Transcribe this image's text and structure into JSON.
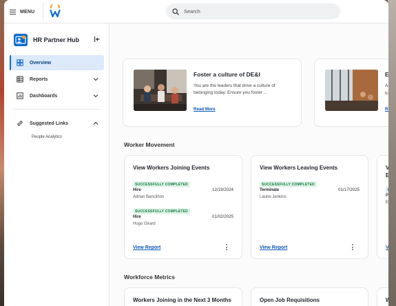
{
  "topbar": {
    "menu_label": "MENU",
    "search_placeholder": "Search"
  },
  "sidebar": {
    "hub_title": "HR Partner Hub",
    "items": [
      {
        "label": "Overview",
        "icon": "dashboard-icon"
      },
      {
        "label": "Reports",
        "icon": "table-icon"
      },
      {
        "label": "Dashboards",
        "icon": "chart-icon"
      }
    ],
    "suggested": {
      "label": "Suggested Links",
      "icon": "link-icon"
    },
    "suggested_items": [
      "People Analytics"
    ]
  },
  "features": [
    {
      "title": "Foster a culture of DE&I",
      "description": "You are the leaders that drive a culture of belonging today. Ensure you foster ...",
      "link": "Read More"
    },
    {
      "title": "Er",
      "description": "As",
      "description2": "tc",
      "link": "Re"
    }
  ],
  "worker_movement": {
    "title": "Worker Movement",
    "cards": [
      {
        "title": "View Workers Joining Events",
        "events": [
          {
            "status": "SUCCESSFULLY COMPLETED",
            "type": "Hire",
            "date": "12/19/2024",
            "name": "Adrian Bancilhon"
          },
          {
            "status": "SUCCESSFULLY COMPLETED",
            "type": "Hire",
            "date": "01/02/2025",
            "name": "Hugo Girard"
          }
        ],
        "link": "View Report"
      },
      {
        "title": "View Workers Leaving Events",
        "events": [
          {
            "status": "SUCCESSFULLY COMPLETED",
            "type": "Terminate",
            "date": "01/17/2025",
            "name": "Laurie Jenkins"
          }
        ],
        "link": "View Report"
      },
      {
        "title_line1": "Vi",
        "title_line2": "Ev",
        "badge": "IN",
        "line1": "Pr",
        "line2": "Er",
        "link": "Vi"
      }
    ]
  },
  "workforce_metrics": {
    "title": "Workforce Metrics",
    "cards": [
      {
        "title": "Workers Joining in the Next 3 Months"
      },
      {
        "title": "Open Job Requisitions"
      },
      {
        "title": "W"
      }
    ]
  },
  "colors": {
    "accent": "#0b6ad1",
    "active_bg": "#dbe9fb",
    "link": "#0b57b7",
    "success_text": "#0a7a3c",
    "success_bg": "#e2f4e8",
    "brand_orange": "#f5a623"
  }
}
